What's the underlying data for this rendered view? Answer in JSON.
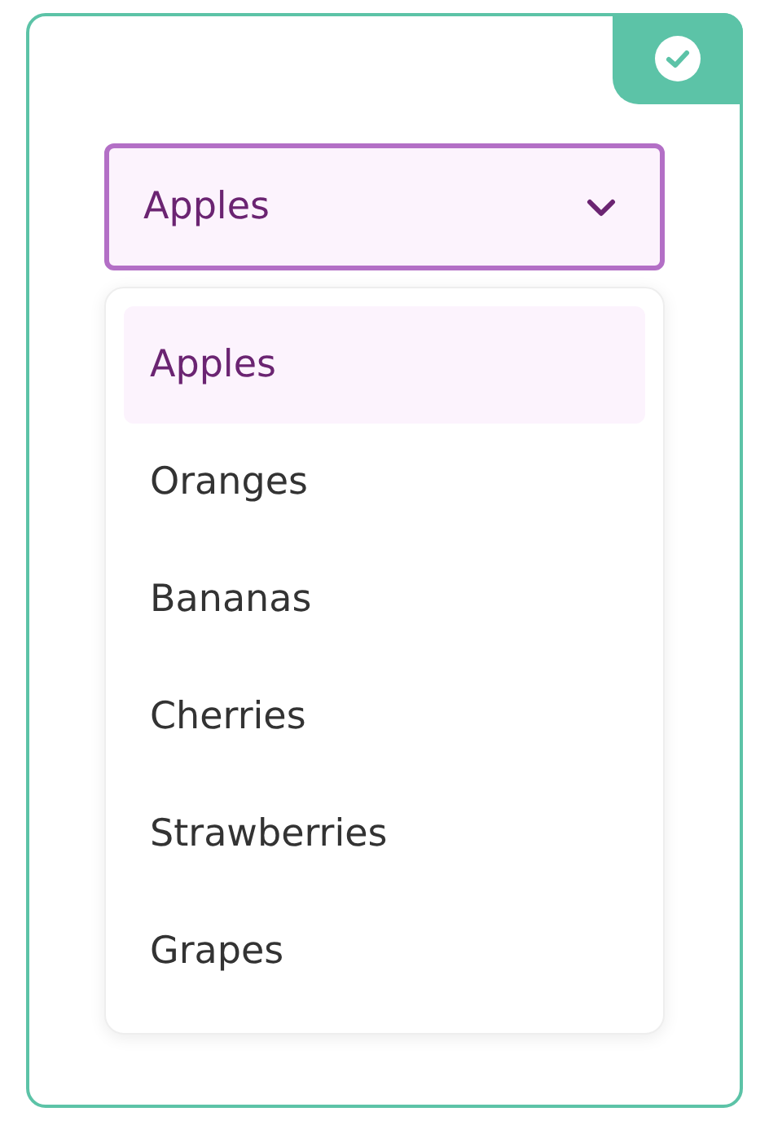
{
  "status_badge": {
    "checked": true
  },
  "select": {
    "value": "Apples",
    "expanded": true
  },
  "options": [
    {
      "label": "Apples",
      "selected": true
    },
    {
      "label": "Oranges",
      "selected": false
    },
    {
      "label": "Bananas",
      "selected": false
    },
    {
      "label": "Cherries",
      "selected": false
    },
    {
      "label": "Strawberries",
      "selected": false
    },
    {
      "label": "Grapes",
      "selected": false
    }
  ]
}
